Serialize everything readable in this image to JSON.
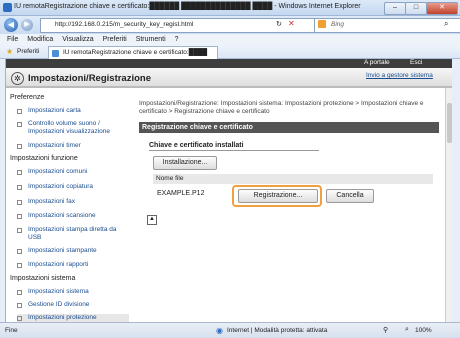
{
  "window": {
    "title": "IU remotaRegistrazione chiave e certificato:██████ ██████████████ ████ - Windows Internet Explorer",
    "minimize": "–",
    "maximize": "□",
    "close": "✕"
  },
  "address_bar": {
    "url": "http://192.168.0.215/m_security_key_regist.html",
    "search_placeholder": "Bing"
  },
  "menu": [
    "File",
    "Modifica",
    "Visualizza",
    "Preferiti",
    "Strumenti",
    "?"
  ],
  "favorites": {
    "label": "Preferiti",
    "tab_title": "IU remotaRegistrazione chiave e certificato:████"
  },
  "header": {
    "title": "Impostazioni/Registrazione",
    "portal_link": "A portale",
    "exit_link": "Esci",
    "send_admin_link": "Invio a gestore sistema"
  },
  "sidebar": {
    "sections": [
      {
        "heading": "Preferenze",
        "items": [
          "Impostazioni carta",
          "Controllo volume suono / Impostazioni visualizzazione",
          "Impostazioni timer"
        ]
      },
      {
        "heading": "Impostazioni funzione",
        "items": [
          "Impostazioni comuni",
          "Impostazioni copiatura",
          "Impostazioni fax",
          "Impostazioni scansione",
          "Impostazioni stampa diretta da USB",
          "Impostazioni stampante",
          "Impostazioni rapporti"
        ]
      },
      {
        "heading": "Impostazioni sistema",
        "items": [
          "Impostazioni sistema",
          "Gestione ID divisione",
          "Impostazioni protezione"
        ]
      }
    ]
  },
  "main": {
    "breadcrumb": "Impostazioni/Registrazione: Impostazioni sistema: Impostazioni protezione > Impostazioni chiave e certificato > Registrazione chiave e certificato",
    "section_title": "Registrazione chiave e certificato",
    "subsection_title": "Chiave e certificato installati",
    "install_button": "Installazione...",
    "column_header": "Nome file",
    "row_file": "EXAMPLE.P12",
    "register_button": "Registrazione...",
    "delete_button": "Cancella"
  },
  "status_bar": {
    "left": "Fine",
    "zone": "Internet | Modalità protetta: attivata",
    "zoom": "100%"
  }
}
